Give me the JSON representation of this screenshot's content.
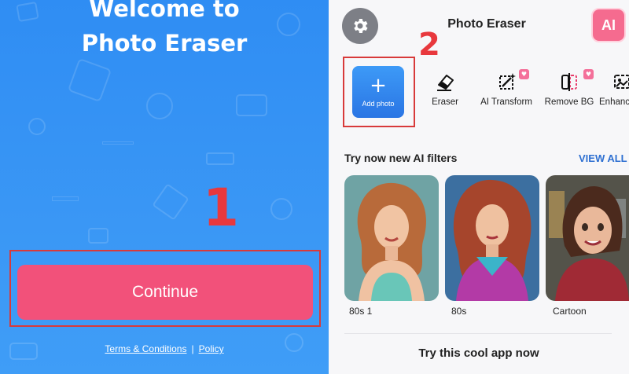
{
  "left": {
    "welcome_line1": "Welcome to",
    "welcome_line2": "Photo Eraser",
    "step_number": "1",
    "continue_label": "Continue",
    "terms_label": "Terms & Conditions",
    "separator": "|",
    "policy_label": "Policy"
  },
  "right": {
    "app_title": "Photo Eraser",
    "ai_badge": "AI",
    "step_number": "2",
    "tools": [
      {
        "label": "Add photo",
        "icon": "plus-icon"
      },
      {
        "label": "Eraser",
        "icon": "eraser-icon"
      },
      {
        "label": "AI Transform",
        "icon": "ai-transform-icon",
        "premium": true
      },
      {
        "label": "Remove BG",
        "icon": "remove-bg-icon",
        "premium": true
      },
      {
        "label": "Enhanc",
        "icon": "enhance-icon"
      }
    ],
    "filters_title": "Try now new AI filters",
    "view_all": "VIEW ALL",
    "filters": [
      {
        "label": "80s 1"
      },
      {
        "label": "80s"
      },
      {
        "label": "Cartoon"
      }
    ],
    "footer_text": "Try this cool app now"
  },
  "colors": {
    "left_bg": "#3a97f5",
    "continue_btn": "#f2517a",
    "annotation_red": "#d83a3a",
    "accent_blue": "#2d6fd1",
    "ai_badge": "#f56b8f"
  }
}
